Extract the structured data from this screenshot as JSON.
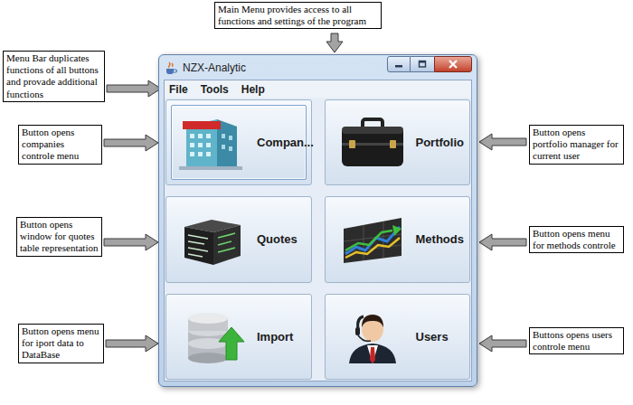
{
  "callouts": [
    "Main Menu provides access to all functions and settings of the program",
    "Menu Bar duplicates functions of all buttons and provade additional functions",
    "Button opens companies controle menu",
    "Button opens window for quotes table representation",
    "Button opens menu for iport data to DataBase",
    "Button opens portfolio manager for current user",
    "Button opens menu for methods controle",
    "Buttons opens users controle menu"
  ],
  "window": {
    "title": "NZX-Analytic"
  },
  "menu_bar": [
    "File",
    "Tools",
    "Help"
  ],
  "buttons": [
    {
      "label": "Compan...",
      "focused": true
    },
    {
      "label": "Portfolio",
      "focused": false
    },
    {
      "label": "Quotes",
      "focused": false
    },
    {
      "label": "Methods",
      "focused": false
    },
    {
      "label": "Import",
      "focused": false
    },
    {
      "label": "Users",
      "focused": false
    }
  ]
}
